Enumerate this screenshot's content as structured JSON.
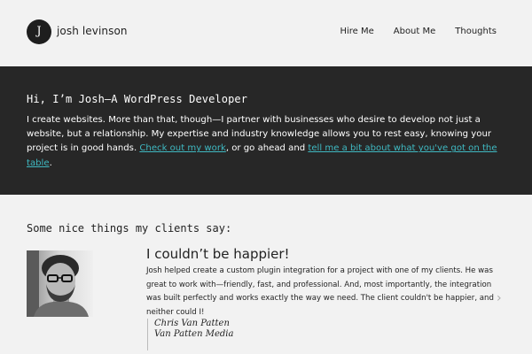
{
  "header": {
    "logo_letter": "J",
    "site_name": "josh levinson",
    "nav": [
      {
        "label": "Hire Me"
      },
      {
        "label": "About Me"
      },
      {
        "label": "Thoughts"
      }
    ]
  },
  "hero": {
    "title": "Hi, I’m Josh—A WordPress Developer",
    "text_1": "I create websites. More than that, though—I partner with businesses who desire to develop not just a website, but a relationship. My expertise and industry knowledge allows you to rest easy, knowing your project is in good hands. ",
    "link_1": "Check out my work",
    "text_2": ", or go ahead and ",
    "link_2": "tell me a bit about what you've got on the table",
    "text_3": "."
  },
  "testimonials": {
    "section_title": "Some nice things my clients say:",
    "items": [
      {
        "title": "I couldn’t be happier!",
        "text": "Josh helped create a custom plugin integration for a project with one of my clients. He was great to work with—friendly, fast, and professional. And, most importantly, the integration was built perfectly and works exactly the way we need. The client couldn't be happier, and neither could I!",
        "author": "Chris Van Patten",
        "company": "Van Patten Media"
      }
    ],
    "next_icon": "chevron-right-icon"
  },
  "colors": {
    "background": "#f2f2f2",
    "hero_background": "#272727",
    "link_accent": "#3fb9c2"
  }
}
